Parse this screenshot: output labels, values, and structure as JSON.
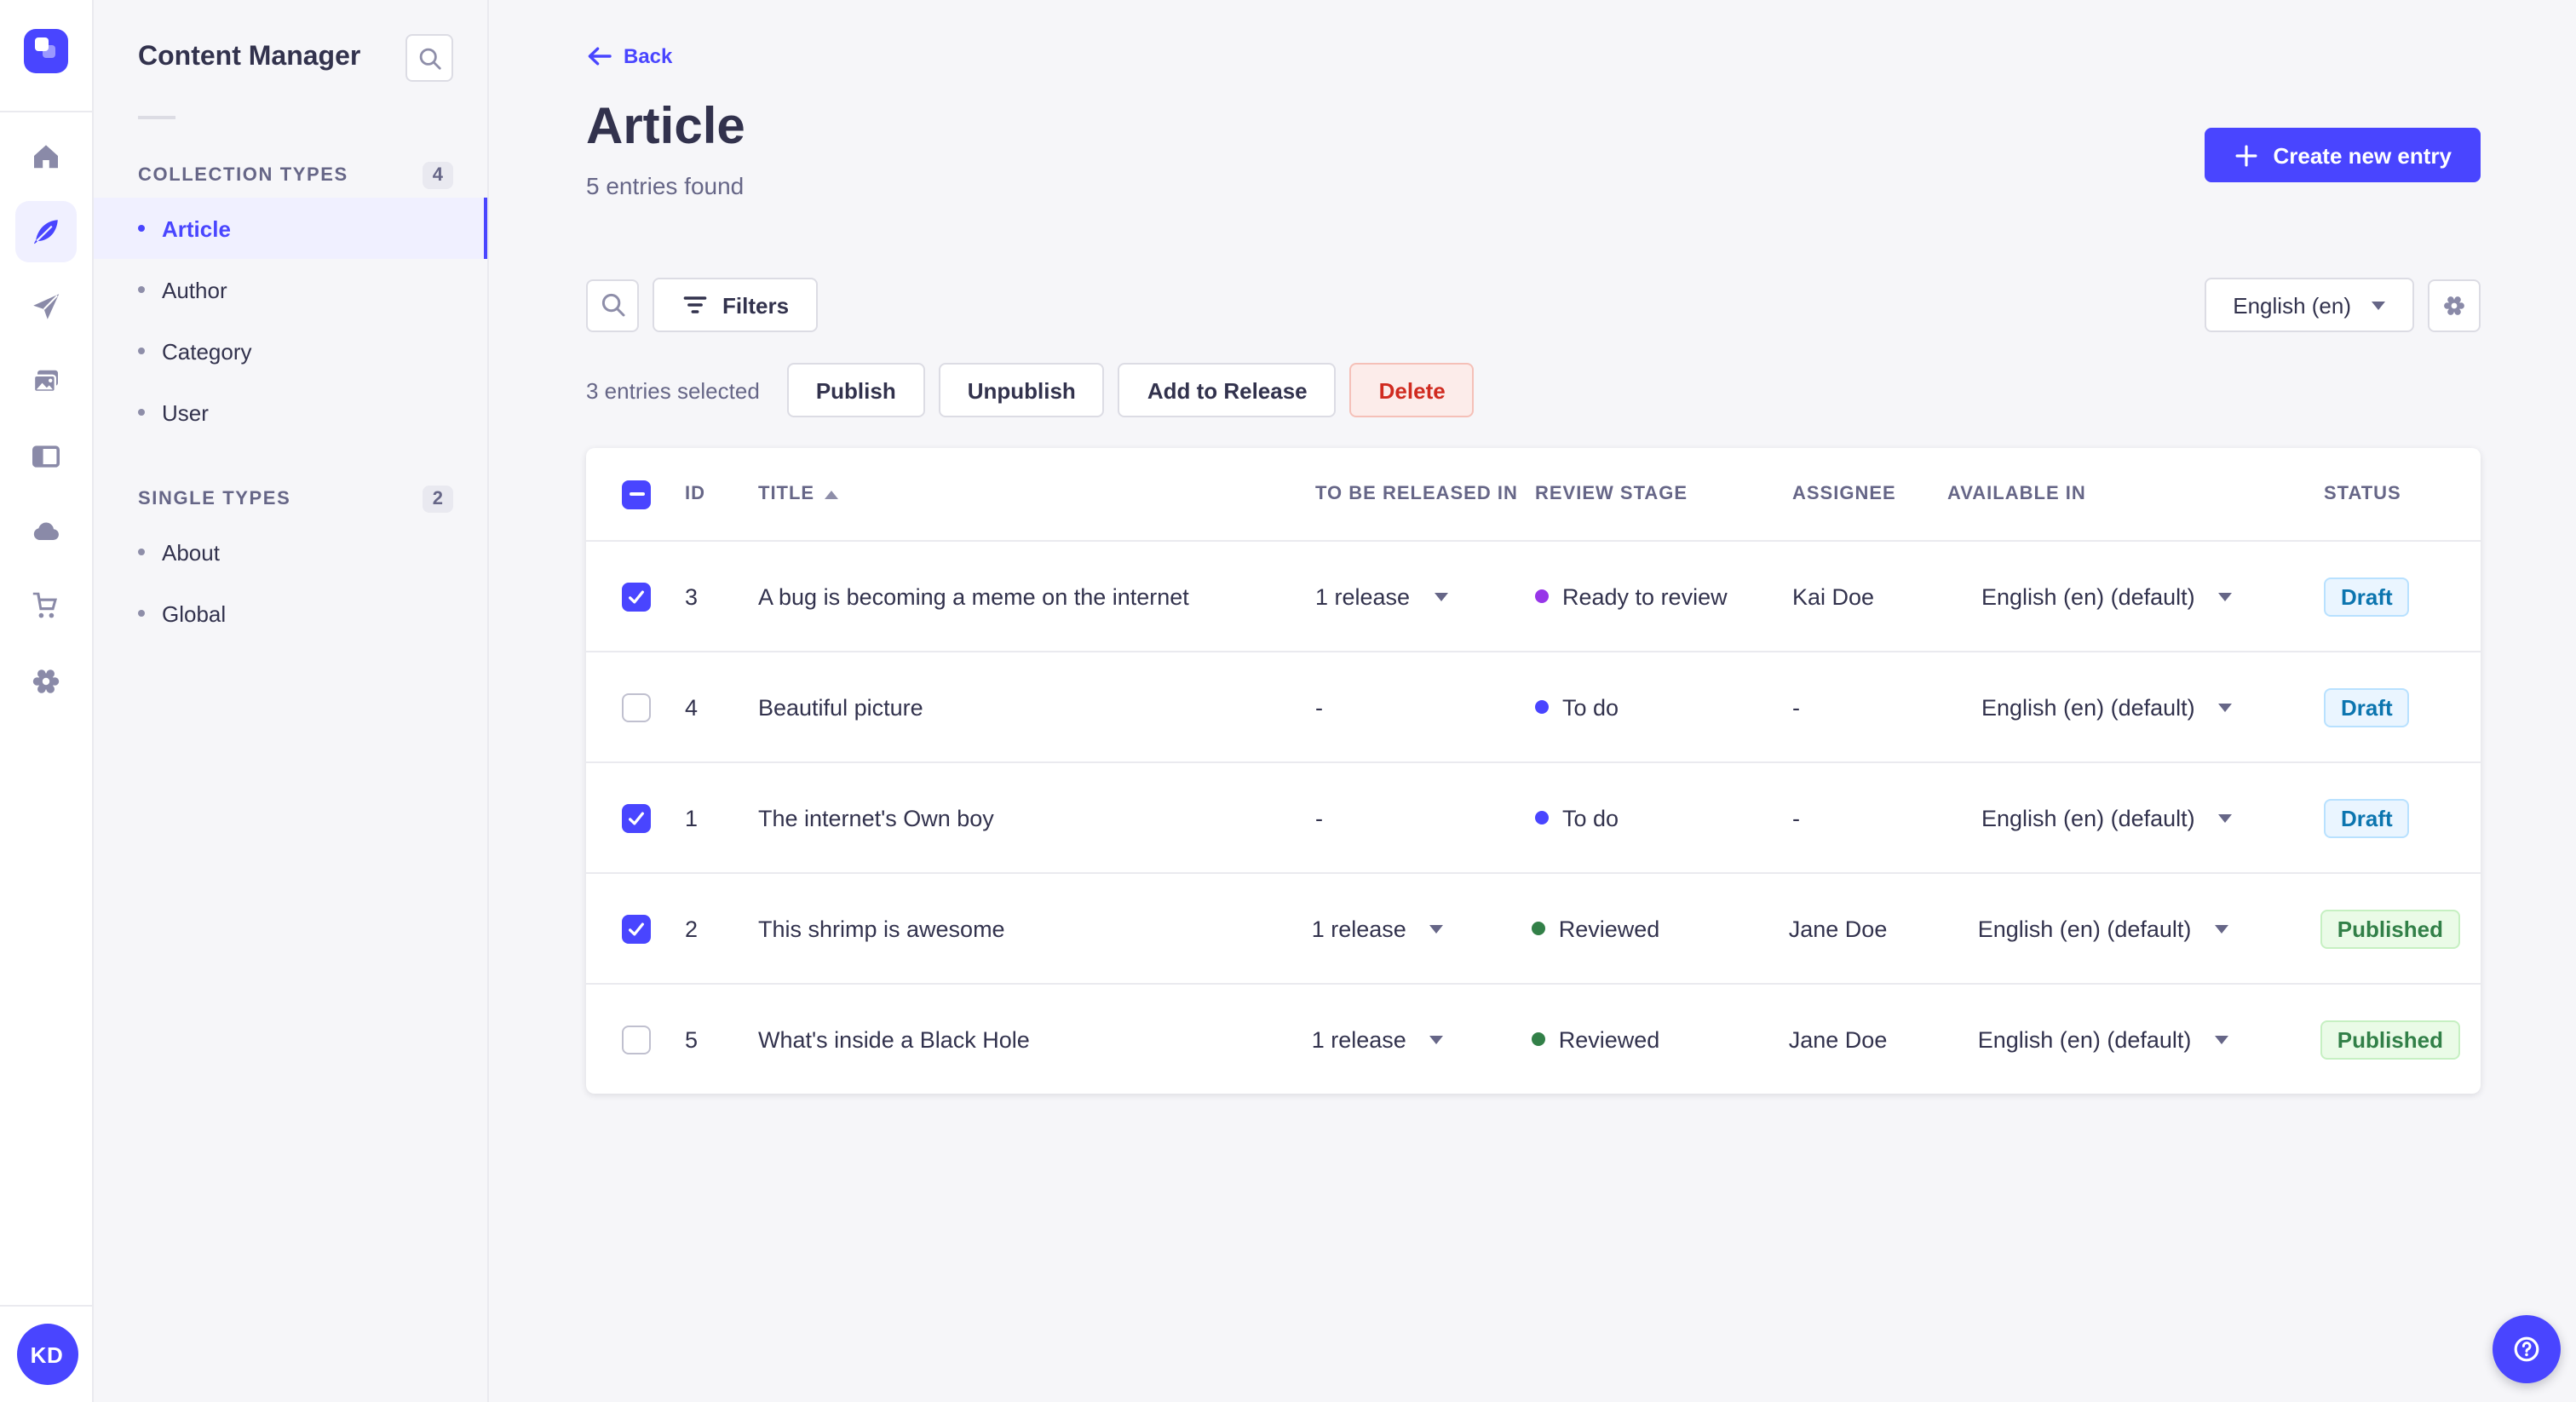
{
  "rail": {
    "icons": [
      {
        "name": "home-icon",
        "active": false
      },
      {
        "name": "feather-icon",
        "active": true
      },
      {
        "name": "paper-plane-icon",
        "active": false
      },
      {
        "name": "media-library-icon",
        "active": false
      },
      {
        "name": "layout-icon",
        "active": false
      },
      {
        "name": "cloud-icon",
        "active": false
      },
      {
        "name": "cart-icon",
        "active": false
      },
      {
        "name": "gear-icon",
        "active": false
      }
    ],
    "avatar_initials": "KD"
  },
  "subnav": {
    "title": "Content Manager",
    "sections": [
      {
        "label": "COLLECTION TYPES",
        "count": "4",
        "items": [
          {
            "label": "Article",
            "active": true
          },
          {
            "label": "Author",
            "active": false
          },
          {
            "label": "Category",
            "active": false
          },
          {
            "label": "User",
            "active": false
          }
        ]
      },
      {
        "label": "SINGLE TYPES",
        "count": "2",
        "items": [
          {
            "label": "About",
            "active": false
          },
          {
            "label": "Global",
            "active": false
          }
        ]
      }
    ]
  },
  "header": {
    "back_label": "Back",
    "title": "Article",
    "subtitle": "5 entries found",
    "create_button": "Create new entry"
  },
  "toolbar": {
    "filters_label": "Filters",
    "locale_selected": "English (en)"
  },
  "bulkbar": {
    "selected_text": "3 entries selected",
    "publish": "Publish",
    "unpublish": "Unpublish",
    "add_to_release": "Add to Release",
    "delete": "Delete"
  },
  "table": {
    "headers": {
      "id": "ID",
      "title": "TITLE",
      "release": "TO BE RELEASED IN",
      "stage": "REVIEW STAGE",
      "assignee": "ASSIGNEE",
      "available": "AVAILABLE IN",
      "status": "STATUS"
    },
    "rows": [
      {
        "checked": true,
        "id": "3",
        "title": "A bug is becoming a meme on the internet",
        "release": "1 release",
        "stage": "Ready to review",
        "stage_color": "#9736e8",
        "assignee": "Kai Doe",
        "available": "English (en) (default)",
        "status": "Draft",
        "status_variant": "draft"
      },
      {
        "checked": false,
        "id": "4",
        "title": "Beautiful picture",
        "release": "-",
        "stage": "To do",
        "stage_color": "#4945ff",
        "assignee": "-",
        "available": "English (en) (default)",
        "status": "Draft",
        "status_variant": "draft"
      },
      {
        "checked": true,
        "id": "1",
        "title": "The internet's Own boy",
        "release": "-",
        "stage": "To do",
        "stage_color": "#4945ff",
        "assignee": "-",
        "available": "English (en) (default)",
        "status": "Draft",
        "status_variant": "draft"
      },
      {
        "checked": true,
        "id": "2",
        "title": "This shrimp is awesome",
        "release": "1 release",
        "stage": "Reviewed",
        "stage_color": "#328048",
        "assignee": "Jane Doe",
        "available": "English (en) (default)",
        "status": "Published",
        "status_variant": "published"
      },
      {
        "checked": false,
        "id": "5",
        "title": "What's inside a Black Hole",
        "release": "1 release",
        "stage": "Reviewed",
        "stage_color": "#328048",
        "assignee": "Jane Doe",
        "available": "English (en) (default)",
        "status": "Published",
        "status_variant": "published"
      }
    ]
  },
  "colors": {
    "brand": "#4945ff",
    "text_primary": "#32324d",
    "text_secondary": "#666687",
    "border": "#eaeaef",
    "draft_text": "#0c75af",
    "published_text": "#328048",
    "danger_text": "#d02b20"
  }
}
